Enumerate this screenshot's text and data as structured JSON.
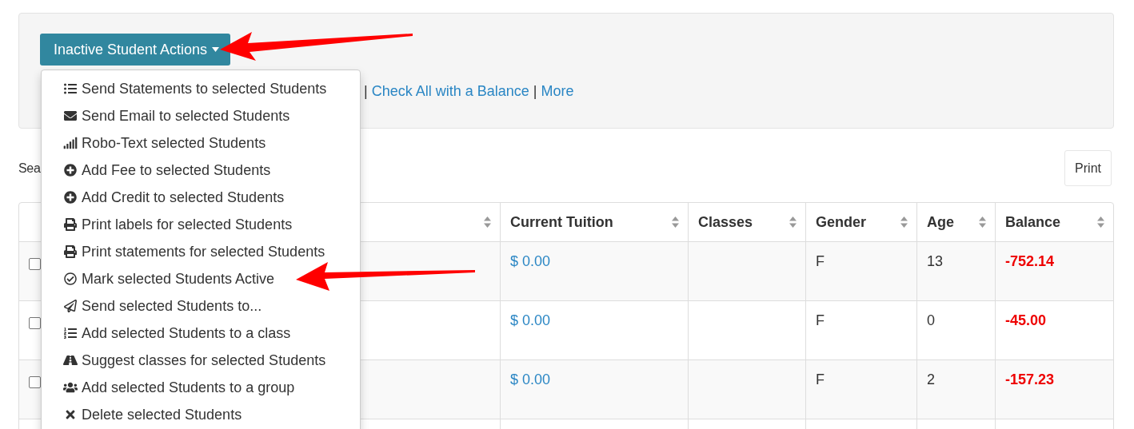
{
  "actions_button": {
    "label": "Inactive Student Actions",
    "expanded": true
  },
  "actions_menu": [
    {
      "label": "Send Statements to selected Students"
    },
    {
      "label": "Send Email to selected Students"
    },
    {
      "label": "Robo-Text selected Students"
    },
    {
      "label": "Add Fee to selected Students"
    },
    {
      "label": "Add Credit to selected Students"
    },
    {
      "label": "Print labels for selected Students"
    },
    {
      "label": "Print statements for selected Students"
    },
    {
      "label": "Mark selected Students Active"
    },
    {
      "label": "Send selected Students to..."
    },
    {
      "label": "Add selected Students to a class"
    },
    {
      "label": "Suggest classes for selected Students"
    },
    {
      "label": "Add selected Students to a group"
    },
    {
      "label": "Delete selected Students"
    }
  ],
  "check_links": [
    {
      "kind": "separator",
      "text": "|"
    },
    {
      "kind": "link",
      "text": "Check All with a Balance"
    },
    {
      "kind": "separator",
      "text": "|"
    },
    {
      "kind": "link",
      "text": "More"
    }
  ],
  "search_label": "Sea",
  "print_button": "Print",
  "table": {
    "columns": [
      "",
      "Current Tuition",
      "Classes",
      "Gender",
      "Age",
      "Balance"
    ],
    "rows": [
      {
        "checked": false,
        "tuition": "$ 0.00",
        "classes": "",
        "gender": "F",
        "age": "13",
        "balance": "-752.14"
      },
      {
        "checked": false,
        "tuition": "$ 0.00",
        "classes": "",
        "gender": "F",
        "age": "0",
        "balance": "-45.00"
      },
      {
        "checked": false,
        "tuition": "$ 0.00",
        "classes": "",
        "gender": "F",
        "age": "2",
        "balance": "-157.23"
      }
    ]
  }
}
